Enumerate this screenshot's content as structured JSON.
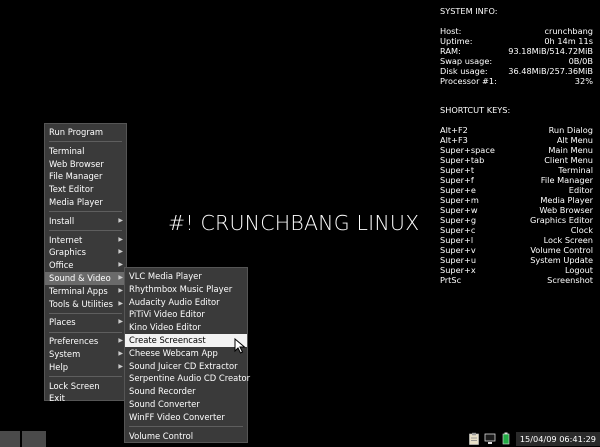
{
  "conky": {
    "system_header": "SYSTEM INFO:",
    "system": [
      {
        "label": "Host:",
        "value": "crunchbang"
      },
      {
        "label": "Uptime:",
        "value": "0h 14m 11s"
      },
      {
        "label": "RAM:",
        "value": "93.18MiB/514.72MiB"
      },
      {
        "label": "Swap usage:",
        "value": "0B/0B"
      },
      {
        "label": "Disk usage:",
        "value": "36.48MiB/257.36MiB"
      },
      {
        "label": "Processor #1:",
        "value": "32%"
      }
    ],
    "shortcut_header": "SHORTCUT KEYS:",
    "shortcuts": [
      {
        "key": "Alt+F2",
        "action": "Run Dialog"
      },
      {
        "key": "Alt+F3",
        "action": "Alt Menu"
      },
      {
        "key": "Super+space",
        "action": "Main Menu"
      },
      {
        "key": "Super+tab",
        "action": "Client Menu"
      },
      {
        "key": "Super+t",
        "action": "Terminal"
      },
      {
        "key": "Super+f",
        "action": "File Manager"
      },
      {
        "key": "Super+e",
        "action": "Editor"
      },
      {
        "key": "Super+m",
        "action": "Media Player"
      },
      {
        "key": "Super+w",
        "action": "Web Browser"
      },
      {
        "key": "Super+g",
        "action": "Graphics Editor"
      },
      {
        "key": "Super+c",
        "action": "Clock"
      },
      {
        "key": "Super+l",
        "action": "Lock Screen"
      },
      {
        "key": "Super+v",
        "action": "Volume Control"
      },
      {
        "key": "Super+u",
        "action": "System Update"
      },
      {
        "key": "Super+x",
        "action": "Logout"
      },
      {
        "key": "PrtSc",
        "action": "Screenshot"
      }
    ]
  },
  "brand": "#! CRUNCHBANG LINUX",
  "main_menu": [
    {
      "label": "Run Program"
    },
    {
      "sep": true
    },
    {
      "label": "Terminal"
    },
    {
      "label": "Web Browser"
    },
    {
      "label": "File Manager"
    },
    {
      "label": "Text Editor"
    },
    {
      "label": "Media Player"
    },
    {
      "sep": true
    },
    {
      "label": "Install",
      "sub": true
    },
    {
      "sep": true
    },
    {
      "label": "Internet",
      "sub": true
    },
    {
      "label": "Graphics",
      "sub": true
    },
    {
      "label": "Office",
      "sub": true
    },
    {
      "label": "Sound & Video",
      "sub": true,
      "active": true
    },
    {
      "label": "Terminal Apps",
      "sub": true
    },
    {
      "label": "Tools & Utilities",
      "sub": true
    },
    {
      "sep": true
    },
    {
      "label": "Places",
      "sub": true
    },
    {
      "sep": true
    },
    {
      "label": "Preferences",
      "sub": true
    },
    {
      "label": "System",
      "sub": true
    },
    {
      "label": "Help",
      "sub": true
    },
    {
      "sep": true
    },
    {
      "label": "Lock Screen"
    },
    {
      "label": "Exit"
    }
  ],
  "sub_menu": [
    {
      "label": "VLC Media Player"
    },
    {
      "label": "Rhythmbox Music Player"
    },
    {
      "label": "Audacity Audio Editor"
    },
    {
      "label": "PiTiVi Video Editor"
    },
    {
      "label": "Kino Video Editor"
    },
    {
      "label": "Create Screencast",
      "highlight": true
    },
    {
      "label": "Cheese Webcam App"
    },
    {
      "label": "Sound Juicer CD Extractor"
    },
    {
      "label": "Serpentine Audio CD Creator"
    },
    {
      "label": "Sound Recorder"
    },
    {
      "label": "Sound Converter"
    },
    {
      "label": "WinFF Video Converter"
    },
    {
      "sep": true
    },
    {
      "label": "Volume Control"
    }
  ],
  "clock": "15/04/09 06:41:29",
  "colors": {
    "desktop": "#000000",
    "menu_bg": "#3a3a3a",
    "menu_active": "#6a6a6a",
    "menu_highlight": "#f2f2f2"
  },
  "icons": {
    "tray": [
      "clipboard-icon",
      "network-icon",
      "power-icon"
    ],
    "pointer": "mouse-cursor-icon"
  }
}
